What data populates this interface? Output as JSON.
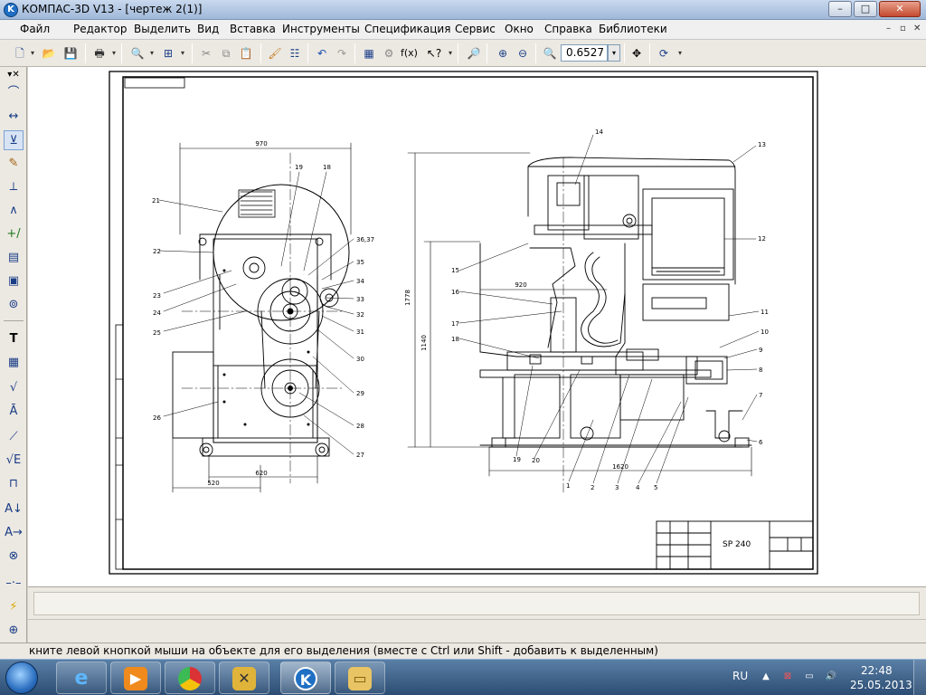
{
  "window": {
    "title": "КОМПАС-3D V13 - [чертеж 2(1)]",
    "app_icon": "K",
    "btn_minimize": "–",
    "btn_maximize": "□",
    "btn_close": "✕"
  },
  "menu": {
    "items": [
      "Файл",
      "Редактор",
      "Выделить",
      "Вид",
      "Вставка",
      "Инструменты",
      "Спецификация",
      "Сервис",
      "Окно",
      "Справка",
      "Библиотеки"
    ],
    "doc_minimize": "–",
    "doc_restore": "▫",
    "doc_close": "✕"
  },
  "toolbar": {
    "zoom_value": "0.6527",
    "icons": [
      "new-icon",
      "open-icon",
      "save-icon",
      "print-icon",
      "preview-icon",
      "page-setup-icon",
      "cut-icon",
      "copy-icon",
      "paste-icon",
      "format-brush-icon",
      "properties-icon",
      "undo-icon",
      "redo-icon",
      "manager-icon",
      "library-icon",
      "variables-icon",
      "help-pointer-icon",
      "zoom-window-icon",
      "zoom-in-icon",
      "zoom-out-icon",
      "zoom-scale-icon",
      "pan-icon",
      "refresh-icon"
    ]
  },
  "left_panel": {
    "icons": [
      "geometry-icon",
      "dimensions-icon",
      "notation-icon",
      "edit-icon",
      "parametrization-icon",
      "measure-icon",
      "select-icon",
      "associative-views-icon",
      "spec-icon",
      "reports-icon",
      "insert-icon",
      "text-icon",
      "table-icon",
      "roughness-icon",
      "base-icon",
      "leader-icon",
      "tolerance-icon",
      "section-line-icon",
      "view-arrow-icon",
      "center-mark-icon",
      "axis-line-icon",
      "lightning-icon",
      "snap-icon",
      "more-icon"
    ]
  },
  "drawing": {
    "dims": {
      "d970": "970",
      "d1778": "1778",
      "d1140": "1140",
      "d920": "920",
      "d1620": "1620",
      "d620": "620",
      "d520": "520"
    },
    "callouts_left": [
      "21",
      "22",
      "23",
      "24",
      "25",
      "26",
      "19",
      "18",
      "36,37",
      "35",
      "34",
      "33",
      "32",
      "31",
      "30",
      "29",
      "28",
      "27"
    ],
    "callouts_right": [
      "14",
      "13",
      "12",
      "11",
      "10",
      "9",
      "8",
      "7",
      "6",
      "15",
      "16",
      "17",
      "18",
      "19",
      "20",
      "1",
      "2",
      "3",
      "4",
      "5"
    ],
    "stamp_title": "SP 240"
  },
  "status": {
    "message": "кните левой кнопкой мыши на объекте для его выделения (вместе с Ctrl или Shift - добавить к выделенным)"
  },
  "taskbar": {
    "language": "RU",
    "time": "22:48",
    "date": "25.05.2013",
    "apps": [
      "ie-icon",
      "media-player-icon",
      "chrome-icon",
      "games-icon",
      "kompas-icon",
      "explorer-icon"
    ],
    "colors": {
      "taskbar": "#2c4d73",
      "kompas": "#1f6fc4"
    }
  }
}
